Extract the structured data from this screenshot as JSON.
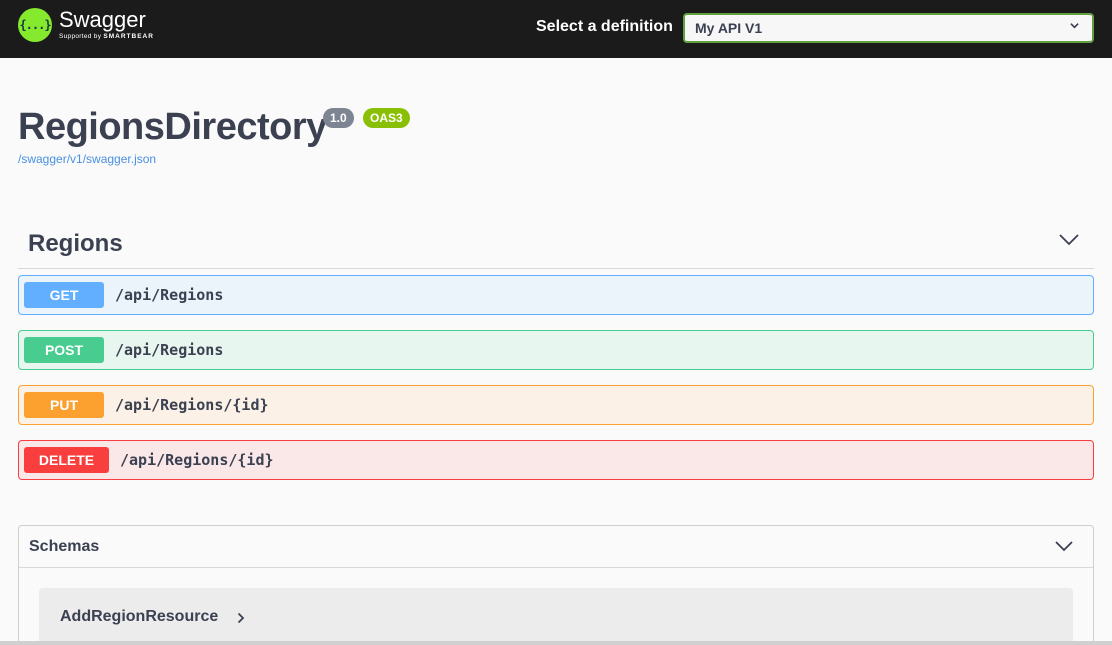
{
  "topbar": {
    "logo_glyph": "{...}",
    "logo_title": "Swagger",
    "logo_supported": "Supported by",
    "logo_company": "SMARTBEAR",
    "definition_label": "Select a definition",
    "definition_selected": "My API V1"
  },
  "info": {
    "title": "RegionsDirectory",
    "version": "1.0",
    "oas": "OAS3",
    "spec_url": "/swagger/v1/swagger.json"
  },
  "tag": {
    "name": "Regions",
    "operations": [
      {
        "method": "GET",
        "path": "/api/Regions"
      },
      {
        "method": "POST",
        "path": "/api/Regions"
      },
      {
        "method": "PUT",
        "path": "/api/Regions/{id}"
      },
      {
        "method": "DELETE",
        "path": "/api/Regions/{id}"
      }
    ]
  },
  "schemas": {
    "title": "Schemas",
    "models": [
      {
        "name": "AddRegionResource"
      }
    ]
  },
  "colors": {
    "get": "#61affe",
    "post": "#49cc90",
    "put": "#fca130",
    "delete": "#f93e3e",
    "logo": "#85ea2d",
    "topbar": "#1b1b1b"
  },
  "icons": {
    "logo": "swagger-logo-icon",
    "select_chevron": "chevron-down-icon",
    "tag_chevron": "chevron-down-icon",
    "schemas_chevron": "chevron-down-icon",
    "model_expand": "chevron-right-icon"
  }
}
